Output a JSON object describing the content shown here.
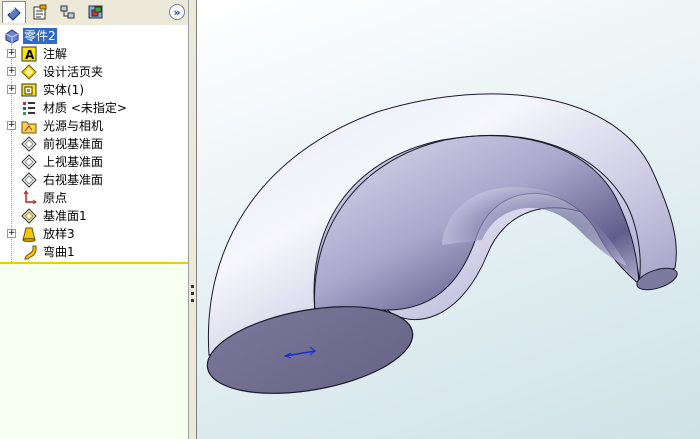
{
  "feature_tree": {
    "tabs": [
      {
        "name": "featuremanager-tab",
        "active": true
      },
      {
        "name": "propertymanager-tab",
        "active": false
      },
      {
        "name": "configurationmanager-tab",
        "active": false
      },
      {
        "name": "dimxpert-tab",
        "active": false
      }
    ],
    "more_label": "»",
    "items": [
      {
        "label": "零件2",
        "icon": "part-icon",
        "expander": "",
        "selected": true
      },
      {
        "label": "注解",
        "icon": "annotations-icon",
        "expander": "+"
      },
      {
        "label": "设计活页夹",
        "icon": "design-binder-icon",
        "expander": "+"
      },
      {
        "label": "实体(1)",
        "icon": "solid-bodies-icon",
        "expander": "+"
      },
      {
        "label": "材质 <未指定>",
        "icon": "material-icon",
        "expander": ""
      },
      {
        "label": "光源与相机",
        "icon": "lights-cameras-icon",
        "expander": "+"
      },
      {
        "label": "前视基准面",
        "icon": "plane-icon",
        "expander": ""
      },
      {
        "label": "上视基准面",
        "icon": "plane-icon",
        "expander": ""
      },
      {
        "label": "右视基准面",
        "icon": "plane-icon",
        "expander": ""
      },
      {
        "label": "原点",
        "icon": "origin-icon",
        "expander": ""
      },
      {
        "label": "基准面1",
        "icon": "plane-icon",
        "expander": ""
      },
      {
        "label": "放样3",
        "icon": "loft-icon",
        "expander": "+"
      },
      {
        "label": "弯曲1",
        "icon": "flex-icon",
        "expander": ""
      }
    ]
  },
  "colors": {
    "selection": "#316ac5",
    "rollback_bar": "#e8d000",
    "panel_lower": "#f7fff1",
    "model_light": "#eeeef8",
    "model_mid": "#b9b8d8",
    "model_dark": "#6e6a98",
    "face_end": "#747096"
  }
}
